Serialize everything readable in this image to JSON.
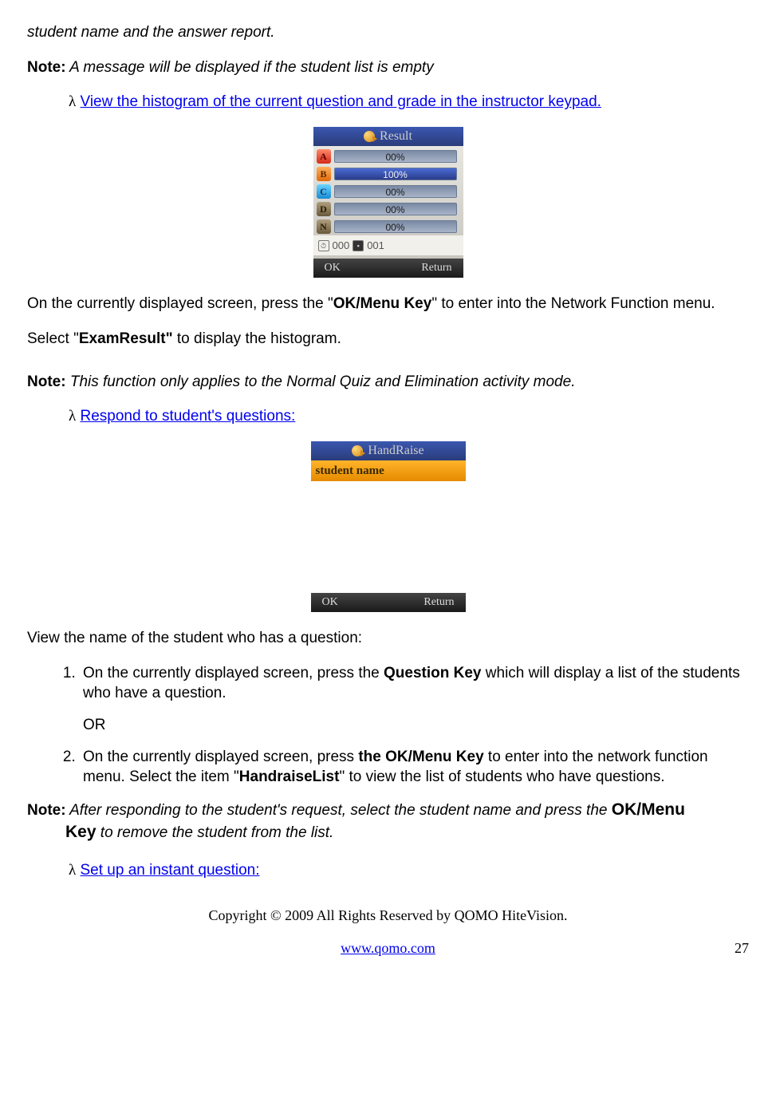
{
  "intro_line": "student name and the answer report.",
  "note1_label": "Note:",
  "note1_text": " A message will be displayed if the student list is empty",
  "lambda": "λ",
  "link_histogram": "View the histogram of the current question and grade in the instructor keypad.",
  "device1": {
    "title": "Result",
    "rows": [
      {
        "letter": "A",
        "cls": "letter-a",
        "pct_label": "00%",
        "pct": 0
      },
      {
        "letter": "B",
        "cls": "letter-b",
        "pct_label": "100%",
        "pct": 100
      },
      {
        "letter": "C",
        "cls": "letter-c",
        "pct_label": "00%",
        "pct": 0
      },
      {
        "letter": "D",
        "cls": "letter-d",
        "pct_label": "00%",
        "pct": 0
      },
      {
        "letter": "N",
        "cls": "letter-n",
        "pct_label": "00%",
        "pct": 0
      }
    ],
    "status_left": "000",
    "status_right": "001",
    "ok": "OK",
    "return": "Return"
  },
  "para_ok_menu_pre": "On the currently displayed screen, press the \"",
  "para_ok_menu_key": "OK/Menu Key",
  "para_ok_menu_post": "\" to enter into the Network Function menu.",
  "para_select_pre": "Select \"",
  "para_select_bold": "ExamResult\"",
  "para_select_post": " to display the histogram.",
  "note2_label": "Note:",
  "note2_text": " This function only applies to the Normal Quiz and Elimination activity mode.",
  "link_respond": "Respond to student's questions:",
  "device2": {
    "title": "HandRaise",
    "student_label": "student name",
    "ok": "OK",
    "return": "Return"
  },
  "para_view_name": "View the name of the student who has a question:",
  "step1_pre": "On the currently displayed screen, press the ",
  "step1_bold": "Question Key",
  "step1_post": " which will display a list of the students who have a question.",
  "or_text": "OR",
  "step2_pre": "On the currently displayed screen, press ",
  "step2_bold1": "the OK/Menu Key",
  "step2_mid": " to enter into the network function menu. Select the item \"",
  "step2_bold2": "HandraiseList",
  "step2_post": "\" to view the list of students who have questions.",
  "note3_label": "Note:",
  "note3_text1": " After responding to the student's request, select the student name and press the ",
  "note3_bold": "OK/Menu Key",
  "note3_text2": " to remove the student from the list.",
  "link_instant": "Set up an instant question:",
  "footer_copy": "Copyright © 2009 All Rights Reserved by QOMO HiteVision.",
  "footer_url": "www.qomo.com",
  "page_number": "27"
}
